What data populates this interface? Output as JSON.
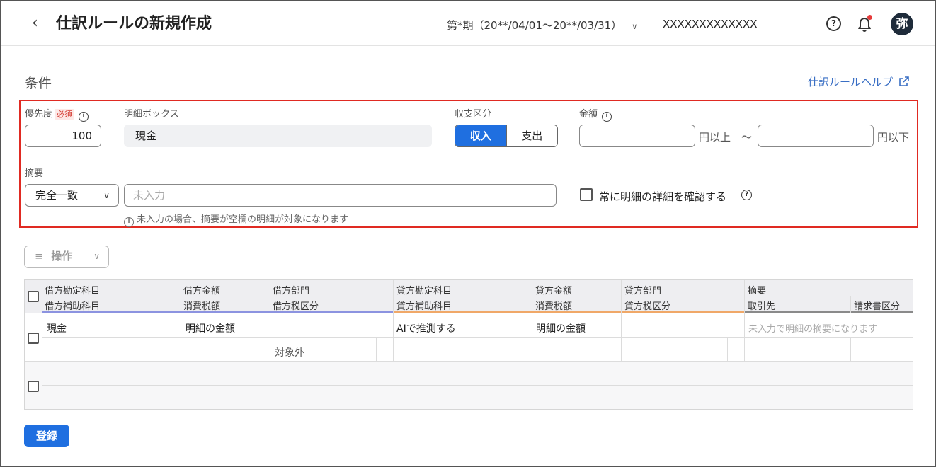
{
  "header": {
    "title": "仕訳ルールの新規作成",
    "period": "第*期（20**/04/01〜20**/03/31）",
    "company": "XXXXXXXXXXXXX",
    "help_icon": "?",
    "avatar": "弥"
  },
  "section_title": "条件",
  "rule_help_link": "仕訳ルールヘルプ",
  "conditions": {
    "priority_label": "優先度",
    "required_badge": "必須",
    "priority_value": "100",
    "detail_box_label": "明細ボックス",
    "detail_box_value": "現金",
    "inout_label": "収支区分",
    "inout_options": [
      "収入",
      "支出"
    ],
    "inout_selected": "収入",
    "amount_label": "金額",
    "amount_min": "",
    "amount_max": "",
    "amount_min_unit": "円以上",
    "tilde": "〜",
    "amount_max_unit": "円以下",
    "summary_label": "摘要",
    "match_type": "完全一致",
    "summary_placeholder": "未入力",
    "summary_note": "未入力の場合、摘要が空欄の明細が対象になります",
    "always_confirm_label": "常に明細の詳細を確認する",
    "always_confirm_checked": false,
    "info_glyph": "i"
  },
  "operations_button": "操作",
  "table": {
    "header_row1": [
      "借方勘定科目",
      "借方金額",
      "借方部門",
      "貸方勘定科目",
      "貸方金額",
      "貸方部門",
      "摘要"
    ],
    "header_row2": [
      "借方補助科目",
      "消費税額",
      "借方税区分",
      "貸方補助科目",
      "消費税額",
      "貸方税区分",
      "取引先",
      "請求書区分"
    ],
    "row1": {
      "debit_account": "現金",
      "debit_amount": "明細の金額",
      "debit_tax_class": "対象外",
      "credit_account": "AIで推測する",
      "credit_amount": "明細の金額",
      "summary_placeholder": "未入力で明細の摘要になります"
    },
    "colors": {
      "debit_accent": "#8c93e0",
      "credit_accent": "#f0a868",
      "other_accent": "#8a8a8a"
    }
  },
  "submit_button": "登録",
  "accent_color": "#1f6fe0",
  "highlight_color": "#e02a22"
}
